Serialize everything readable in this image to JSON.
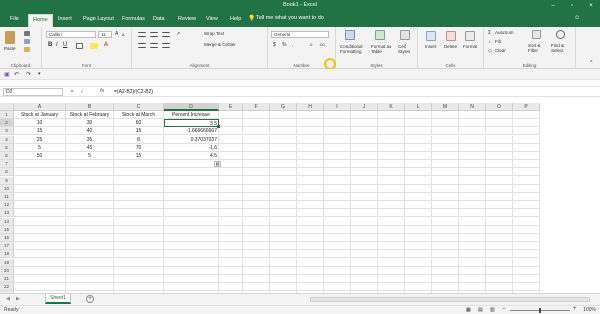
{
  "window": {
    "title": "Book1 - Excel"
  },
  "tabs": [
    "File",
    "Home",
    "Insert",
    "Page Layout",
    "Formulas",
    "Data",
    "Review",
    "View",
    "Help"
  ],
  "active_tab": "Home",
  "tell_me": "Tell me what you want to do",
  "ribbon": {
    "clipboard": {
      "paste": "Paste",
      "label": "Clipboard"
    },
    "font": {
      "name": "Calibri",
      "size": "11",
      "label": "Font"
    },
    "alignment": {
      "wrap": "Wrap Text",
      "merge": "Merge & Center",
      "label": "Alignment"
    },
    "number": {
      "format": "General",
      "label": "Number"
    },
    "styles": {
      "conditional": "Conditional Formatting",
      "format_table": "Format as Table",
      "cell_styles": "Cell Styles",
      "label": "Styles"
    },
    "cells": {
      "insert": "Insert",
      "delete": "Delete",
      "format": "Format",
      "label": "Cells"
    },
    "editing": {
      "autosum": "AutoSum",
      "fill": "Fill",
      "clear": "Clear",
      "sort": "Sort & Filter",
      "find": "Find & Select",
      "label": "Editing"
    }
  },
  "formula_bar": {
    "name_box": "D2",
    "fx": "fx",
    "formula": "=(A2-B2)/(C2-B2)"
  },
  "columns": [
    "A",
    "B",
    "C",
    "D",
    "E",
    "F",
    "G",
    "H",
    "I",
    "J",
    "K",
    "L",
    "M",
    "N",
    "O",
    "P"
  ],
  "rows": [
    "1",
    "2",
    "3",
    "4",
    "5",
    "6",
    "7",
    "8",
    "9",
    "10",
    "11",
    "12",
    "13",
    "14",
    "15",
    "16",
    "17",
    "18",
    "19",
    "20",
    "21",
    "22",
    "23"
  ],
  "sheet": [
    [
      "Stock at January",
      "Stock at February",
      "Stock at March",
      "Percent Increase"
    ],
    [
      "10",
      "30",
      "60",
      "3.5"
    ],
    [
      "15",
      "40",
      "15",
      "-1.666666667"
    ],
    [
      "25",
      "35",
      "8",
      "0.37037037"
    ],
    [
      "5",
      "45",
      "70",
      "-1.6"
    ],
    [
      "50",
      "5",
      "15",
      "4.5"
    ]
  ],
  "sheet_tab": "Sheet1",
  "status": {
    "ready": "Ready",
    "zoom": "100%"
  }
}
